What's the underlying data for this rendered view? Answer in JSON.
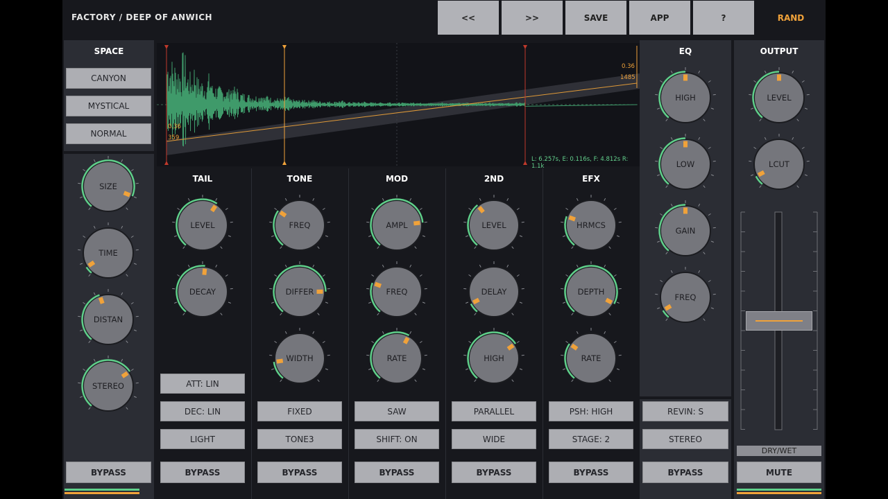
{
  "preset_title": "FACTORY / DEEP OF ANWICH",
  "toolbar": {
    "prev": "<<",
    "next": ">>",
    "save": "SAVE",
    "app": "APP",
    "help": "?",
    "rand": "RAND"
  },
  "colors": {
    "accent": "#f0a23a",
    "ring": "#5fcf8a",
    "panel": "#2b2d34",
    "button": "#adaeb3",
    "wave": "#3f9a6a"
  },
  "space": {
    "title": "SPACE",
    "presets": [
      "CANYON",
      "MYSTICAL",
      "NORMAL"
    ],
    "knobs": [
      {
        "label": "SIZE",
        "value": 0.9
      },
      {
        "label": "TIME",
        "value": 0.06
      },
      {
        "label": "DISTAN",
        "value": 0.43
      },
      {
        "label": "STEREO",
        "value": 0.7
      }
    ],
    "bypass": "BYPASS"
  },
  "waveform": {
    "left_values": [
      "0.36",
      "359"
    ],
    "right_values": [
      "0.36",
      "1485"
    ],
    "stats": "L: 6.257s, E: 0.116s, F: 4.812s R: 1.1k"
  },
  "sections": [
    {
      "title": "TAIL",
      "knobs": [
        {
          "label": "LEVEL",
          "value": 0.62
        },
        {
          "label": "DECAY",
          "value": 0.52
        }
      ],
      "buttons": [
        "ATT: LIN",
        "DEC: LIN",
        "LIGHT"
      ],
      "bypass": "BYPASS"
    },
    {
      "title": "TONE",
      "knobs": [
        {
          "label": "FREQ",
          "value": 0.3
        },
        {
          "label": "DIFFER",
          "value": 0.82
        },
        {
          "label": "WIDTH",
          "value": 0.15
        }
      ],
      "buttons": [
        "FIXED",
        "TONE3"
      ],
      "bypass": "BYPASS"
    },
    {
      "title": "MOD",
      "knobs": [
        {
          "label": "AMPL",
          "value": 0.8
        },
        {
          "label": "FREQ",
          "value": 0.25
        },
        {
          "label": "RATE",
          "value": 0.6
        }
      ],
      "buttons": [
        "SAW",
        "SHIFT: ON"
      ],
      "bypass": "BYPASS"
    },
    {
      "title": "2ND",
      "knobs": [
        {
          "label": "LEVEL",
          "value": 0.36
        },
        {
          "label": "DELAY",
          "value": 0.08
        },
        {
          "label": "HIGH",
          "value": 0.7
        }
      ],
      "buttons": [
        "PARALLEL",
        "WIDE"
      ],
      "bypass": "BYPASS"
    },
    {
      "title": "EFX",
      "knobs": [
        {
          "label": "HRMCS",
          "value": 0.25
        },
        {
          "label": "DEPTH",
          "value": 0.92
        },
        {
          "label": "RATE",
          "value": 0.3
        }
      ],
      "buttons": [
        "PSH: HIGH",
        "STAGE: 2"
      ],
      "bypass": "BYPASS"
    }
  ],
  "eq": {
    "title": "EQ",
    "knobs": [
      {
        "label": "HIGH",
        "value": 0.5
      },
      {
        "label": "LOW",
        "value": 0.5
      },
      {
        "label": "GAIN",
        "value": 0.5
      },
      {
        "label": "FREQ",
        "value": 0.07
      }
    ],
    "buttons": [
      "REVIN: S",
      "STEREO"
    ],
    "bypass": "BYPASS"
  },
  "output": {
    "title": "OUTPUT",
    "knobs": [
      {
        "label": "LEVEL",
        "value": 0.5
      },
      {
        "label": "LCUT",
        "value": 0.08
      }
    ],
    "fader_label": "DRY/WET",
    "fader_value": 0.5,
    "mute": "MUTE"
  }
}
